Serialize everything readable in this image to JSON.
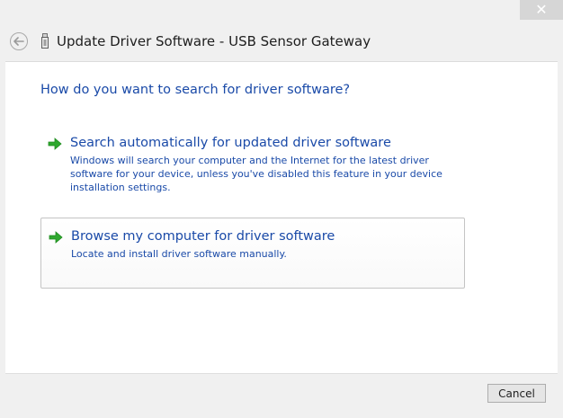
{
  "window": {
    "title": "Update Driver Software - USB Sensor Gateway",
    "close_glyph": "✕"
  },
  "content": {
    "question": "How do you want to search for driver software?",
    "options": [
      {
        "title": "Search automatically for updated driver software",
        "description": "Windows will search your computer and the Internet for the latest driver software for your device, unless you've disabled this feature in your device installation settings.",
        "icon": "green-arrow-icon"
      },
      {
        "title": "Browse my computer for driver software",
        "description": "Locate and install driver software manually.",
        "icon": "green-arrow-icon"
      }
    ]
  },
  "footer": {
    "cancel_label": "Cancel"
  },
  "colors": {
    "link_blue": "#1a4aa8",
    "arrow_green": "#2fa82f",
    "background": "#f0f0f0",
    "panel": "#ffffff"
  }
}
